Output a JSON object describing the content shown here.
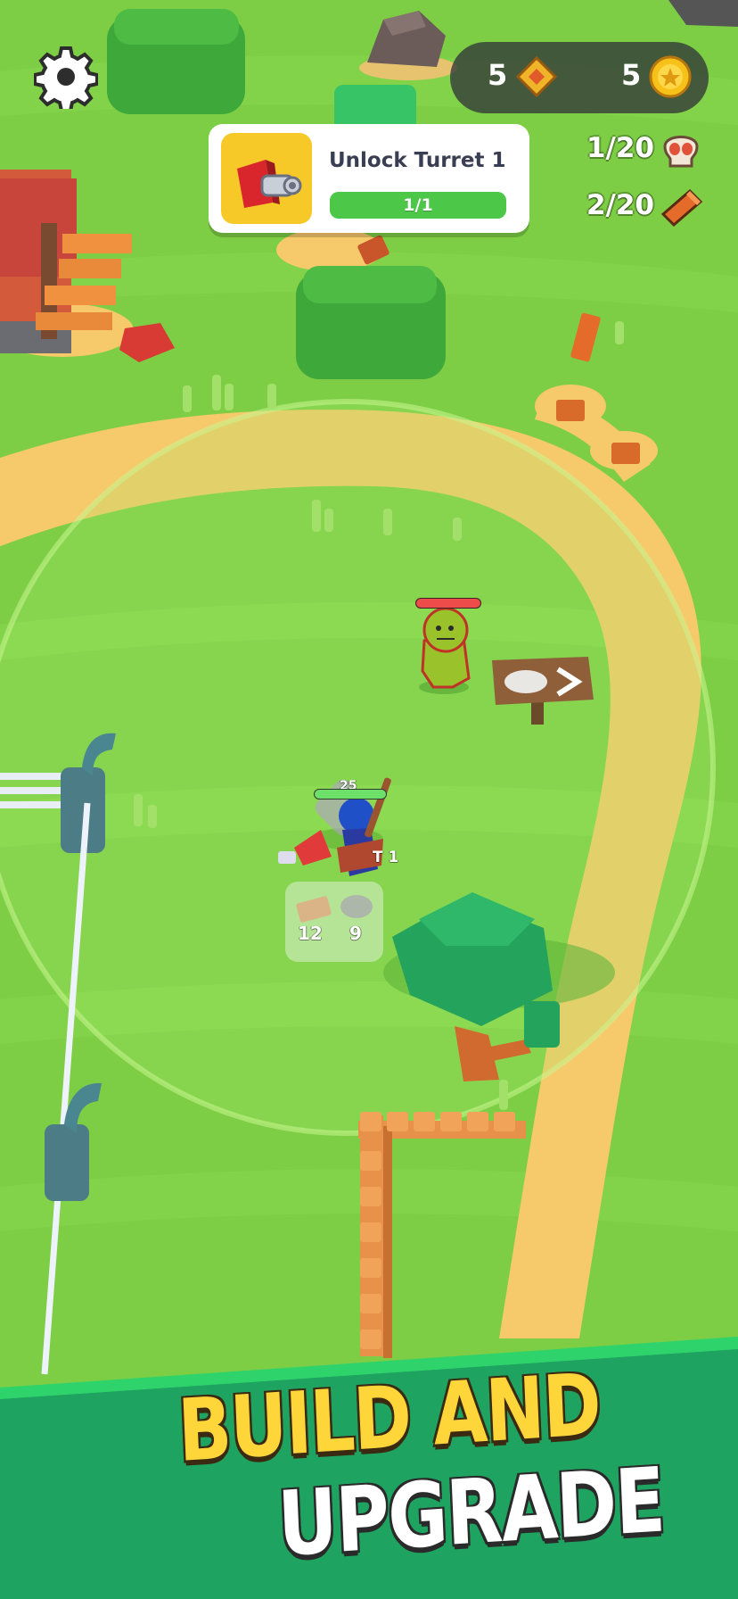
{
  "hud": {
    "settings_icon": "gear-icon",
    "currency": {
      "tickets": {
        "value": "5",
        "icon": "ticket-icon"
      },
      "coins": {
        "value": "5",
        "icon": "coin-icon"
      }
    },
    "quest": {
      "title": "Unlock Turret 1",
      "progress_text": "1/1",
      "progress": 1.0,
      "icon": "turret-icon"
    },
    "counters": {
      "skulls": {
        "value": "1/20",
        "icon": "skull-icon"
      },
      "wood": {
        "value": "2/20",
        "icon": "wood-icon"
      }
    }
  },
  "world": {
    "player": {
      "hp_text": "25",
      "hp": 1.0,
      "carry_label": "T 1"
    },
    "enemy": {
      "hp": 1.0
    },
    "inventory": {
      "wood": {
        "value": "12",
        "icon": "wood-icon"
      },
      "stone": {
        "value": "9",
        "icon": "stone-icon"
      }
    },
    "sign_icon": "stone-arrow-sign-icon"
  },
  "banner": {
    "line1": "BUILD AND",
    "line2": "UPGRADE"
  },
  "colors": {
    "grass": "#7dce45",
    "path": "#f6c96b",
    "banner_green": "#1fa360",
    "banner_top": "#2fd36c",
    "accent_yellow": "#ffd63a",
    "quest_bar": "#4cc747"
  }
}
